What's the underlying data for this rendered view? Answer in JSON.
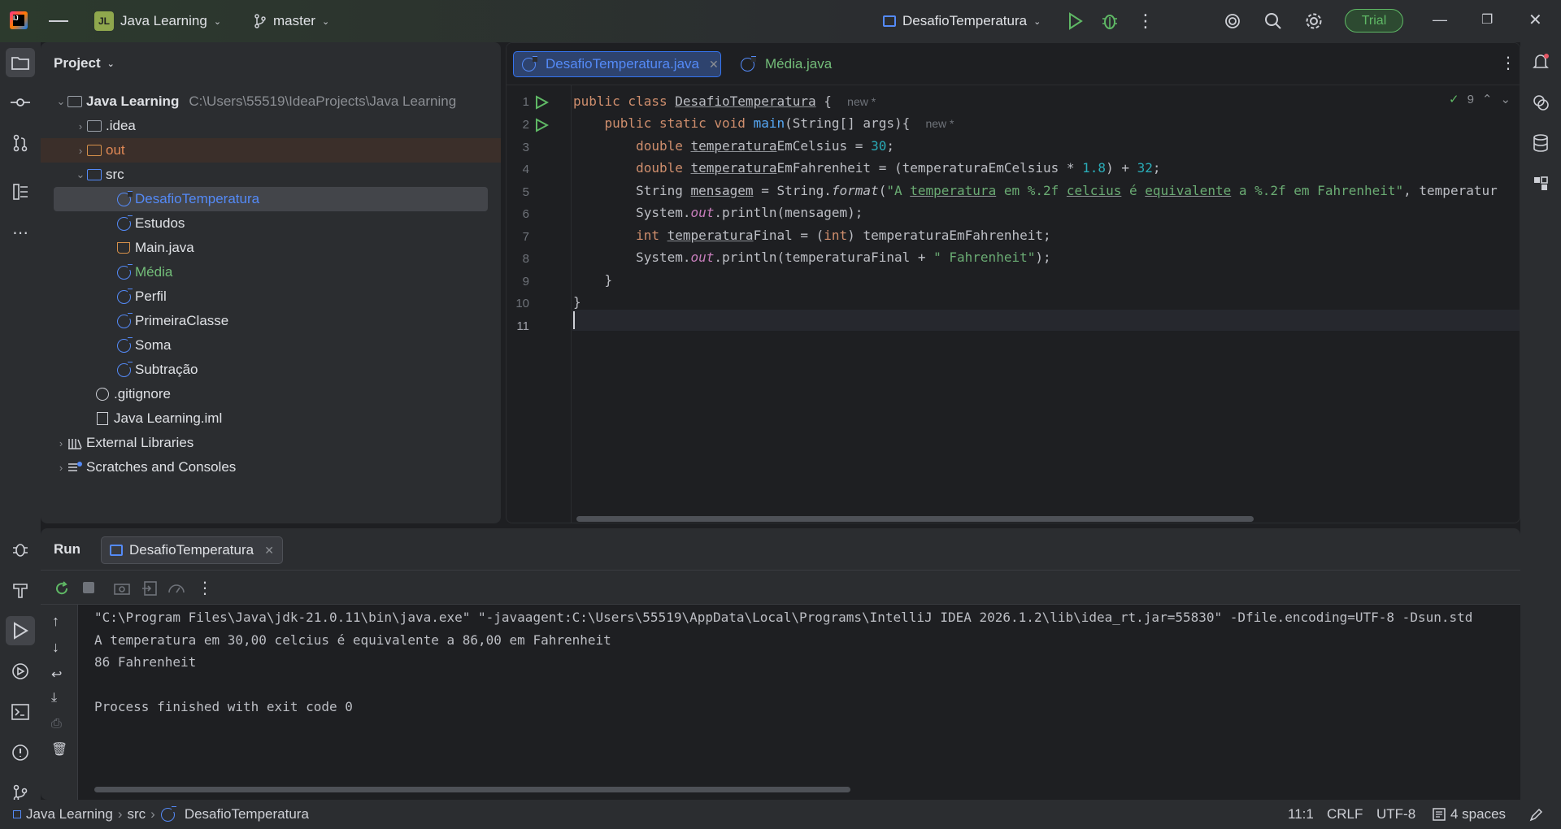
{
  "titlebar": {
    "avatar": "JL",
    "project_name": "Java Learning",
    "branch": "master",
    "run_config": "DesafioTemperatura",
    "trial_label": "Trial"
  },
  "project_panel": {
    "title": "Project",
    "tree": [
      {
        "label": "Java Learning",
        "path": "C:\\Users\\55519\\IdeaProjects\\Java Learning"
      },
      {
        "label": ".idea"
      },
      {
        "label": "out"
      },
      {
        "label": "src"
      },
      {
        "label": "DesafioTemperatura"
      },
      {
        "label": "Estudos"
      },
      {
        "label": "Main.java"
      },
      {
        "label": "Média"
      },
      {
        "label": "Perfil"
      },
      {
        "label": "PrimeiraClasse"
      },
      {
        "label": "Soma"
      },
      {
        "label": "Subtração"
      },
      {
        "label": ".gitignore"
      },
      {
        "label": "Java Learning.iml"
      },
      {
        "label": "External Libraries"
      },
      {
        "label": "Scratches and Consoles"
      }
    ]
  },
  "editor": {
    "tabs": [
      {
        "label": "DesafioTemperatura.java"
      },
      {
        "label": "Média.java"
      }
    ],
    "inspection_count": "9",
    "hint_new": "new *",
    "line_numbers": [
      "1",
      "2",
      "3",
      "4",
      "5",
      "6",
      "7",
      "8",
      "9",
      "10",
      "11"
    ]
  },
  "run_panel": {
    "title": "Run",
    "tab_label": "DesafioTemperatura",
    "console": [
      "\"C:\\Program Files\\Java\\jdk-21.0.11\\bin\\java.exe\" \"-javaagent:C:\\Users\\55519\\AppData\\Local\\Programs\\IntelliJ IDEA 2026.1.2\\lib\\idea_rt.jar=55830\" -Dfile.encoding=UTF-8 -Dsun.std",
      "A temperatura em 30,00 celcius é equivalente a 86,00 em Fahrenheit",
      "86 Fahrenheit",
      "",
      "Process finished with exit code 0"
    ]
  },
  "statusbar": {
    "crumb_project": "Java Learning",
    "crumb_src": "src",
    "crumb_class": "DesafioTemperatura",
    "position": "11:1",
    "line_sep": "CRLF",
    "encoding": "UTF-8",
    "indent": "4 spaces"
  },
  "colors": {
    "accent": "#3574f0",
    "run_green": "#5fb865",
    "background": "#1e1f22",
    "panel": "#2b2d30"
  }
}
